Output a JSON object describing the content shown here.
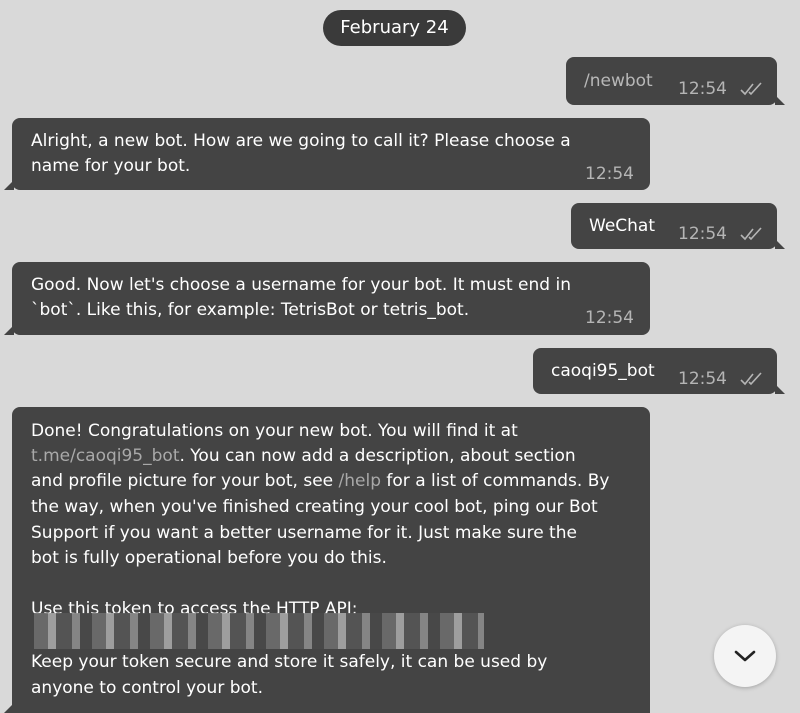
{
  "date_label": "February 24",
  "messages": [
    {
      "direction": "out",
      "text": "/newbot",
      "time": "12:54"
    },
    {
      "direction": "in",
      "lines": [
        "Alright, a new bot. How are we going to call it? Please choose a",
        "name for your bot."
      ],
      "time": "12:54"
    },
    {
      "direction": "out",
      "text": "WeChat",
      "time": "12:54"
    },
    {
      "direction": "in",
      "lines": [
        "Good. Now let's choose a username for your bot. It must end in",
        "`bot`. Like this, for example: TetrisBot or tetris_bot."
      ],
      "time": "12:54"
    },
    {
      "direction": "out",
      "text": "caoqi95_bot",
      "time": "12:54"
    },
    {
      "direction": "in",
      "line1": "Done! Congratulations on your new bot. You will find it at",
      "link1": "t.me/caoqi95_bot",
      "line2_rest": ". You can now add a description, about section",
      "line3_pre": "and profile picture for your bot, see ",
      "link2": "/help",
      "line3_post": " for a list of commands. By",
      "line4": "the way, when you've finished creating your cool bot, ping our Bot",
      "line5": "Support if you want a better username for it. Just make sure the",
      "line6": "bot is fully operational before you do this.",
      "line8": "Use this token to access the HTTP API:",
      "line10": "Keep your token secure and store it safely, it can be used by",
      "line11": "anyone to control your bot."
    }
  ],
  "icons": {
    "read_receipt": "double-check-icon",
    "scroll_down": "chevron-down-icon"
  },
  "colors": {
    "background": "#d9d9d9",
    "bubble": "#444444",
    "text": "#ffffff",
    "time": "#b5b5b5",
    "link": "#a9a9a9"
  }
}
